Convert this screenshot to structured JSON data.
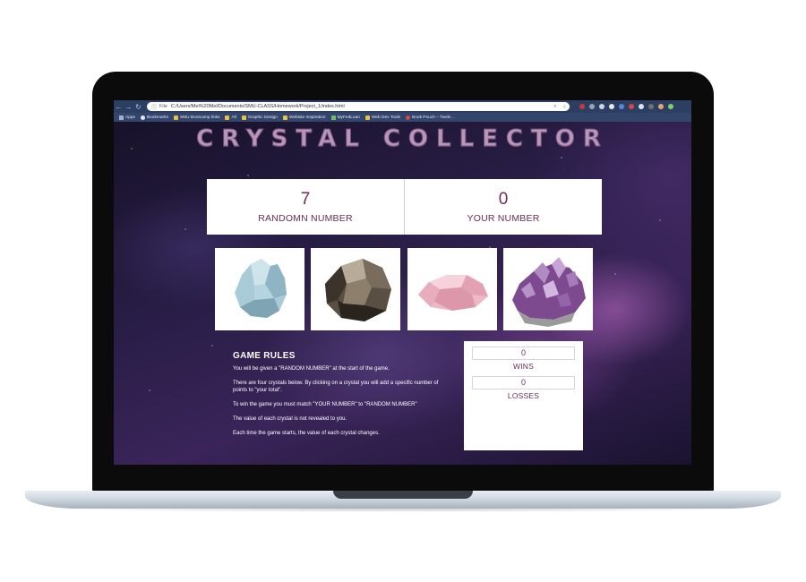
{
  "browser": {
    "file_label": "File",
    "url": "C:/Users/Mel%20Mel/Documents/SMU-CLASS/Homework/Project_1/index.html",
    "bookmarks": [
      "Apps",
      "Bookmarks",
      "SMU Bootcamp links",
      "All",
      "Graphic Design",
      "Website Inspiration",
      "MyFedLoan",
      "Web Dev Tools",
      "Book Pouch – Twelv…"
    ]
  },
  "page": {
    "title": "CRYSTAL COLLECTOR",
    "random": {
      "value": "7",
      "label": "RANDOMN NUMBER"
    },
    "yours": {
      "value": "0",
      "label": "YOUR NUMBER"
    },
    "crystals": [
      "blue-calcite-crystal",
      "smoky-quartz-crystal",
      "rose-quartz-crystal",
      "amethyst-crystal"
    ],
    "rules": {
      "heading": "GAME RULES",
      "lines": [
        "You will be given a \"RANDOM NUMBER\" at the start of the game.",
        "There are four crystals below. By clicking on a crystal you will add a specific number of points to \"your total\".",
        "To win the game you must match \"YOUR NUMBER\" to \"RANDOM NUMBER\"",
        "The value of each crystal is not revealed to you.",
        "Each time the game starts, the value of each crystal changes."
      ]
    },
    "record": {
      "wins_value": "0",
      "wins_label": "WINS",
      "losses_value": "0",
      "losses_label": "LOSSES"
    },
    "colors": {
      "accent": "#6b2d59",
      "title": "#b996b8",
      "chrome": "#2d3e63"
    }
  }
}
